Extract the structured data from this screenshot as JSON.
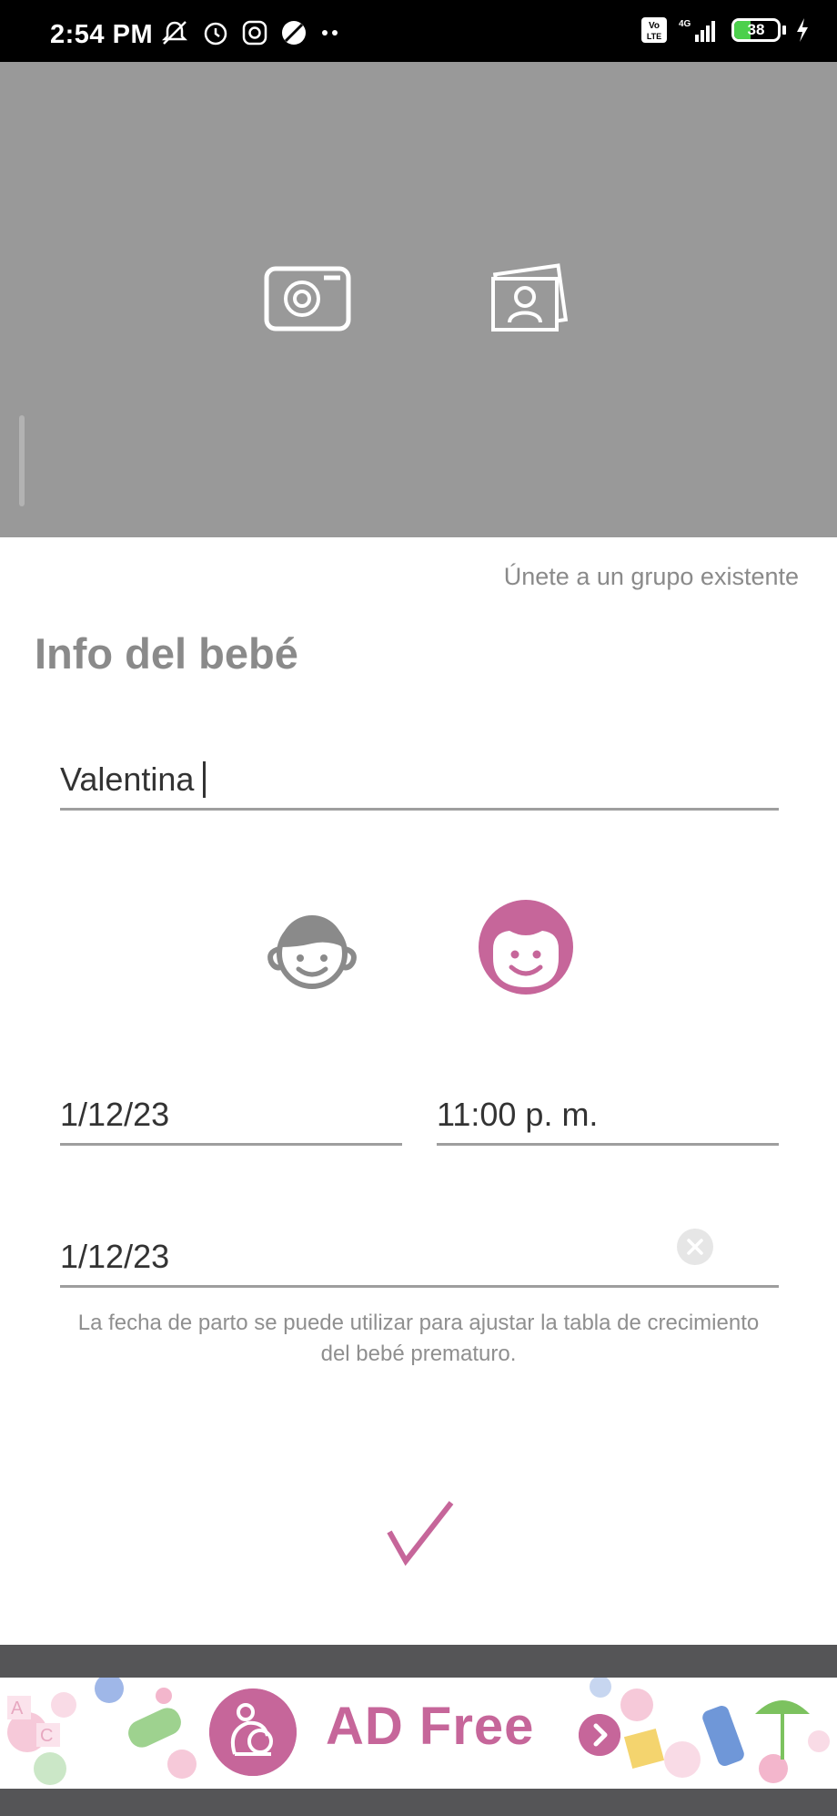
{
  "status_bar": {
    "time": "2:54 PM",
    "battery": "38",
    "battery_level": 0.38,
    "icons": [
      "mute-icon",
      "alarm-icon",
      "instagram-icon",
      "app-icon",
      "more-dots-icon",
      "volte-icon",
      "signal-4g-icon",
      "battery-icon",
      "charging-icon"
    ]
  },
  "photo": {
    "camera_icon": "camera-icon",
    "gallery_icon": "photo-gallery-icon"
  },
  "header": {
    "join_link": "Únete a un grupo existente",
    "title": "Info del bebé"
  },
  "form": {
    "name_value": "Valentina",
    "birth_date": "1/12/23",
    "birth_time": "11:00 p. m.",
    "due_date": "1/12/23",
    "hint": "La fecha de parto se puede utilizar para ajustar la tabla de crecimiento del bebé prematuro.",
    "gender_selected": "girl"
  },
  "colors": {
    "accent": "#c6669a",
    "gray_icon": "#8a8a8a",
    "photo_bg": "#999999"
  },
  "ad": {
    "text": "AD Free"
  }
}
